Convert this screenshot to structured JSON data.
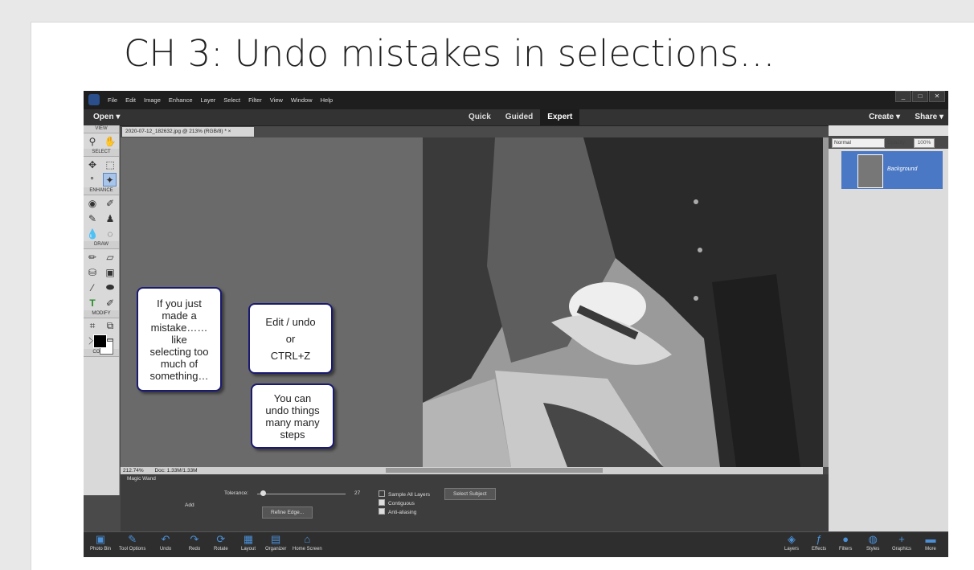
{
  "slide": {
    "title": "CH 3: Undo mistakes in selections…"
  },
  "menubar": {
    "items": [
      "File",
      "Edit",
      "Image",
      "Enhance",
      "Layer",
      "Select",
      "Filter",
      "View",
      "Window",
      "Help"
    ],
    "controls": [
      "_",
      "□",
      "✕"
    ]
  },
  "topbar": {
    "open": "Open ▾",
    "modes": [
      "Quick",
      "Guided",
      "Expert"
    ],
    "active_mode": "Expert",
    "create": "Create ▾",
    "share": "Share ▾"
  },
  "toolbox": {
    "groups": [
      "VIEW",
      "SELECT",
      "ENHANCE",
      "DRAW",
      "MODIFY",
      "COLOR"
    ]
  },
  "document": {
    "tab": "2020-07-12_182632.jpg @ 213% (RGB/8) * ×",
    "zoom": "212.74%",
    "doc_size": "Doc: 1.33M/1.33M"
  },
  "layers": {
    "blend_mode": "Normal",
    "opacity_label": "Opacity:",
    "opacity_value": "100%",
    "layer_name": "Background"
  },
  "tool_options": {
    "tool_name": "Magic Wand",
    "add_label": "Add",
    "tolerance_label": "Tolerance:",
    "tolerance_value": "27",
    "refine_edge": "Refine Edge...",
    "sample_all_layers": "Sample All Layers",
    "contiguous": "Contiguous",
    "anti_aliasing": "Anti-aliasing",
    "select_subject": "Select Subject"
  },
  "bottombar": {
    "items": [
      "Photo Bin",
      "Tool Options",
      "Undo",
      "Redo",
      "Rotate",
      "Layout",
      "Organizer",
      "Home Screen"
    ],
    "right_items": [
      "Layers",
      "Effects",
      "Filters",
      "Styles",
      "Graphics",
      "More"
    ]
  },
  "callouts": {
    "mistake": "If you just\nmade a\nmistake……\nlike\nselecting too\nmuch of\nsomething…",
    "edit_undo": "Edit / undo\nor\nCTRL+Z",
    "undo_steps": "You can\nundo things\nmany many\nsteps"
  }
}
